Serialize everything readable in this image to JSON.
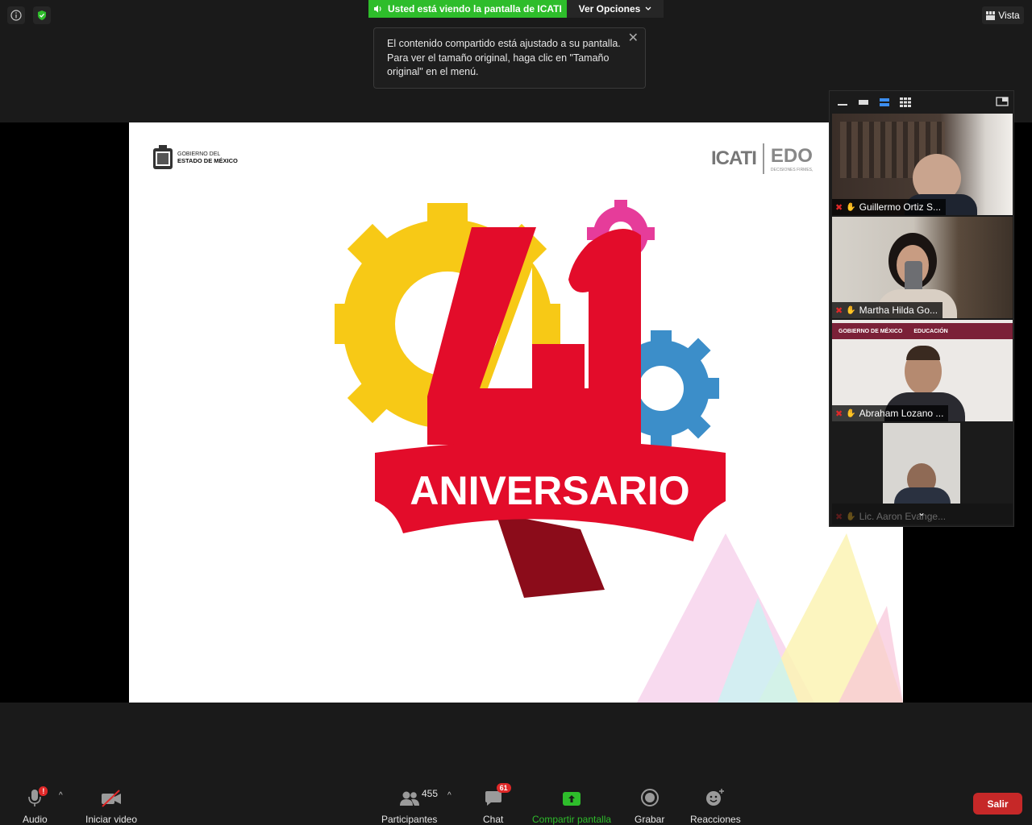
{
  "topbar": {
    "share_banner": "Usted está viendo la pantalla de ICATI",
    "view_options": "Ver Opciones",
    "tooltip_text": "El contenido compartido está ajustado a su pantalla. Para ver el tamaño original, haga clic en \"Tamaño original\" en el menú.",
    "vista_label": "Vista"
  },
  "slide": {
    "gov_line1": "GOBIERNO DEL",
    "gov_line2": "ESTADO DE MÉXICO",
    "icati_logo": "ICATI",
    "edo_text": "EDO",
    "edo_sub": "DECISIONES FIRMES,",
    "number": "41",
    "banner_text": "ANIVERSARIO"
  },
  "gallery": {
    "participants": [
      {
        "name": "Guillermo Ortiz S..."
      },
      {
        "name": "Martha Hilda Go..."
      },
      {
        "name": "Abraham Lozano ..."
      },
      {
        "name": "Lic. Aaron Evange..."
      }
    ],
    "edu_banner_left": "GOBIERNO DE MÉXICO",
    "edu_banner_right": "EDUCACIÓN"
  },
  "toolbar": {
    "audio_label": "Audio",
    "video_label": "Iniciar video",
    "participants_label": "Participantes",
    "participants_count": "455",
    "chat_label": "Chat",
    "chat_badge": "61",
    "share_label": "Compartir pantalla",
    "record_label": "Grabar",
    "reactions_label": "Reacciones",
    "leave_label": "Salir",
    "audio_badge": "!"
  },
  "colors": {
    "share_green": "#2ebd2b",
    "leave_red": "#c62828",
    "gear_yellow": "#f7c916",
    "gear_blue": "#3c8ec9",
    "gear_pink": "#e63c9a",
    "anniversary_red": "#e30c2a"
  }
}
